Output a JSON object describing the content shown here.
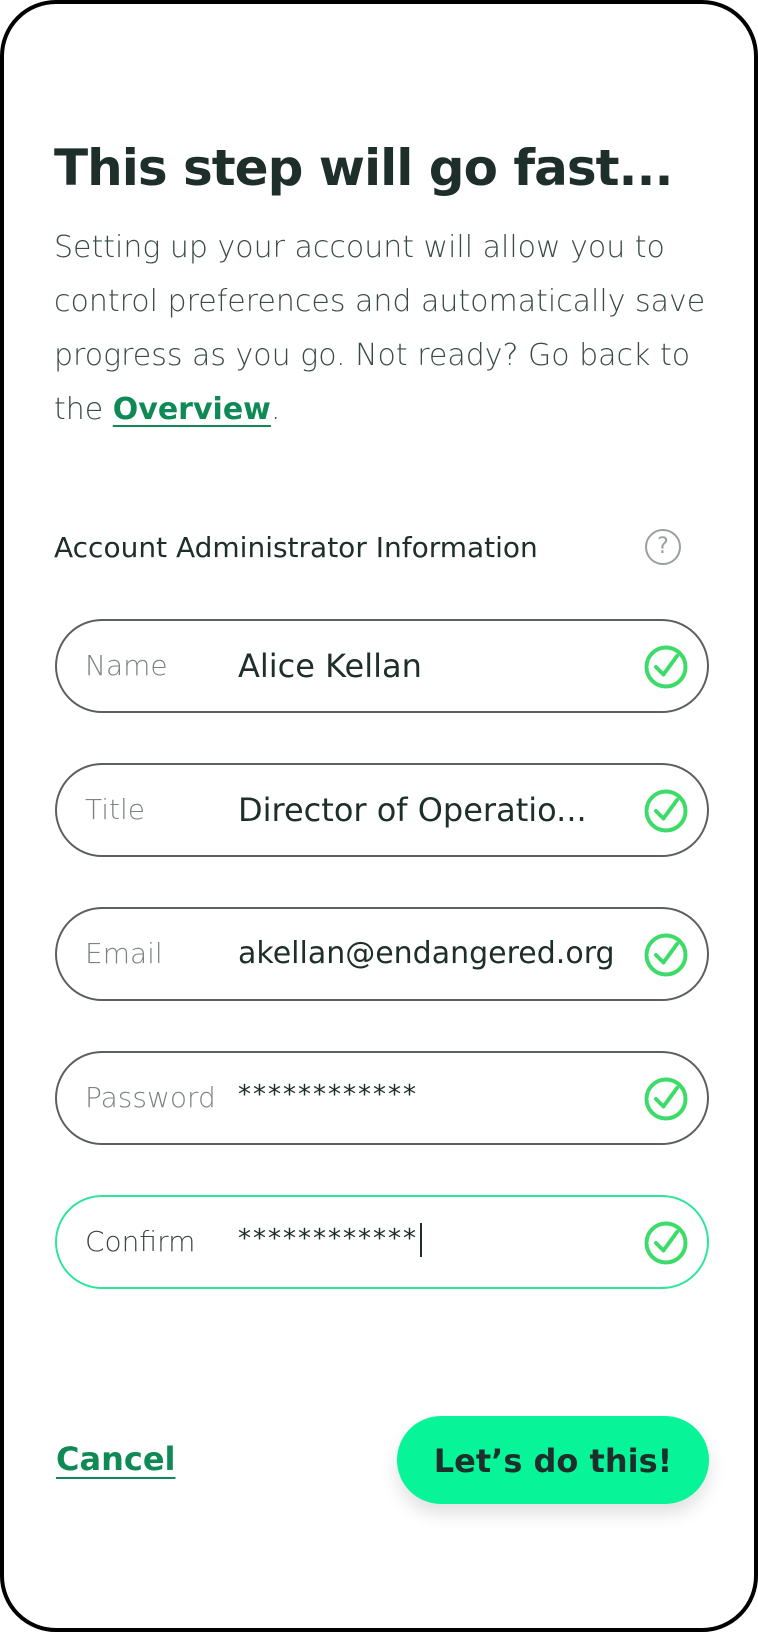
{
  "page": {
    "heading": "This step will go fast...",
    "intro_text": "Setting up your account will allow you to control preferences and automatically save progress as you go. Not ready? Go back to the ",
    "intro_link": "Overview",
    "intro_end": "."
  },
  "section": {
    "title": "Account Administrator Information",
    "help_icon": "?"
  },
  "fields": [
    {
      "label": "Name",
      "value": "Alice Kellan",
      "valid": true
    },
    {
      "label": "Title",
      "value": "Director of Operatio...",
      "valid": true
    },
    {
      "label": "Email",
      "value": "akellan@endangered.org",
      "valid": true
    },
    {
      "label": "Password",
      "value": "************",
      "valid": true
    },
    {
      "label": "Confirm",
      "value": "************",
      "valid": true,
      "focused": true
    }
  ],
  "actions": {
    "cancel_label": "Cancel",
    "submit_label": "Let’s do this!"
  },
  "colors": {
    "accent_green": "#0f8a57",
    "button_green": "#07f499",
    "check_green": "#3ddc6a",
    "focus_border": "#2ee59a",
    "text_dark": "#1e2e2a"
  },
  "icons": {
    "help": "question-circle-icon",
    "valid": "check-circle-icon"
  }
}
